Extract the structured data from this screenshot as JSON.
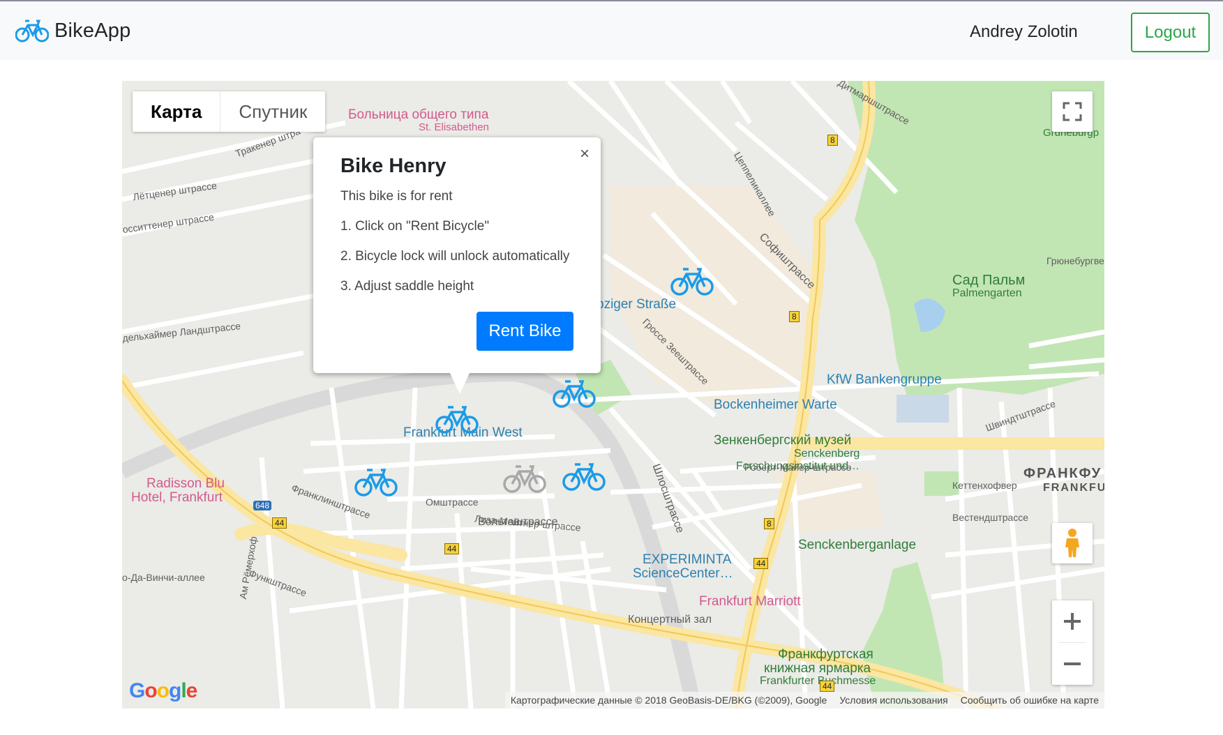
{
  "navbar": {
    "brand": "BikeApp",
    "user_name": "Andrey Zolotin",
    "logout_label": "Logout"
  },
  "map": {
    "type_controls": {
      "map": "Карта",
      "satellite": "Спутник"
    },
    "labels": {
      "hospital": "Больница общего типа",
      "hospital2": "St. Elisabethen",
      "palmengarten_ru": "Сад Пальм",
      "palmengarten_de": "Palmengarten",
      "gruneburg": "Gruneburgp",
      "leipziger": "pziger Straße",
      "kfw": "KfW Bankengruppe",
      "bockenheimer": "Bockenheimer Warte",
      "main_west": "Frankfurt Main West",
      "senckenberg_ru": "Зенкенбергский музей",
      "senckenberg_de1": "Senckenberg",
      "senckenberg_de2": "Forschungsinstitut und…",
      "radisson1": "Radisson Blu",
      "radisson2": "Hotel, Frankfurt",
      "experiminta1": "EXPERIMINTA",
      "experiminta2": "ScienceCenter…",
      "marriott": "Frankfurt Marriott",
      "senckenberganlage": "Senckenberganlage",
      "buchmesse_ru1": "Франкфуртская",
      "buchmesse_ru2": "книжная ярмарка",
      "buchmesse_de": "Frankfurter Buchmesse",
      "frankfurt_ru": "ФРАНКФУ",
      "frankfurt_de": "FRANKFU",
      "volta": "Вольташтрассе",
      "omshtrasse": "Омштрассе",
      "sofistrasse": "Софиштрассе",
      "schlossstrasse": "Шлосштрассе",
      "lyotzener": "Лётценер штрассе",
      "traker": "Тракенер штра",
      "franklinstrasse": "Франклинштрассе",
      "liza": "Лиза-Мейтнер-штрассе",
      "robert": "Роберт-Майер-штрассе",
      "rodelheimer": "дельхаймер Ландштрассе",
      "ammerohof": "Ам Рёмерхоф",
      "westend": "Вестендштрассе",
      "kettenhof": "Кеттенхофвер",
      "grunebur_str": "Грюнебургвег",
      "shvindt": "Швиндтштрассе",
      "dittmar": "Дитмаршштрассе",
      "zeppelin": "Цеппелиналлее",
      "fundstrasse": "Функштрассе",
      "davinci": "о-Да-Винчи-аллее",
      "rossitten": "осситтенер штрассе",
      "grosse_see": "Гроссе Зеештрассе",
      "konzert": "Концертный зал"
    },
    "road_shields": [
      "8",
      "8",
      "8",
      "44",
      "44",
      "44",
      "44",
      "648"
    ],
    "google": "Google",
    "attribution": {
      "data": "Картографические данные © 2018 GeoBasis-DE/BKG (©2009), Google",
      "terms": "Условия использования",
      "report": "Сообщить об ошибке на карте"
    }
  },
  "infowindow": {
    "title": "Bike Henry",
    "subtitle": "This bike is for rent",
    "step1": "1. Click on \"Rent Bicycle\"",
    "step2": "2. Bicycle lock will unlock automatically",
    "step3": "3. Adjust saddle height",
    "rent_label": "Rent Bike",
    "close_label": "×"
  },
  "colors": {
    "bike_available": "#1a9be8",
    "bike_unavailable": "#a8a8a8",
    "primary": "#007bff",
    "success": "#28a745"
  }
}
